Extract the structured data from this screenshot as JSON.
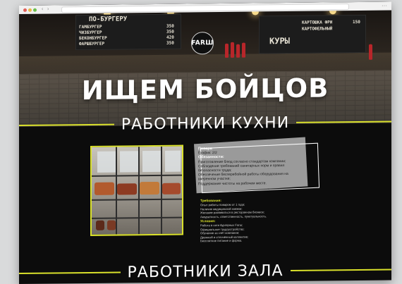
{
  "hero": {
    "logo": "FARШ",
    "title": "ИЩЕМ БОЙЦОВ",
    "board_left": {
      "heading": "ПО-БУРГЕРУ",
      "rows": [
        {
          "name": "ГАМБУРГЕР",
          "price": "350"
        },
        {
          "name": "ЧИЗБУРГЕР",
          "price": "350"
        },
        {
          "name": "БЕКОНБУРГЕР",
          "price": "420"
        },
        {
          "name": "ФАРШБУРГЕР",
          "price": "350"
        }
      ]
    },
    "board_right": {
      "rows": [
        {
          "name": "КАРТОШКА ФРИ",
          "price": "150"
        },
        {
          "name": "КАРТОФЕЛЬНЫЙ",
          "price": ""
        },
        {
          "name": "КУРЫ",
          "price": ""
        }
      ]
    }
  },
  "sections": {
    "kitchen": "РАБОТНИКИ КУХНИ",
    "hall": "РАБОТНИКИ ЗАЛА"
  },
  "vacancy": {
    "title": "Повара",
    "schedule": "График: 2/2",
    "duties_heading": "Обязанности:",
    "duties": [
      "Приготовление блюд согласно стандартам компании;",
      "Соблюдение требований санитарных норм и правил безопасности труда;",
      "Обеспечение бесперебойной работы оборудования на вверенном участке;",
      "Поддержание чистоты на рабочем месте."
    ],
    "requirements_heading": "Требования:",
    "requirements": [
      "Опыт работы поваром от 1 года;",
      "Наличие медицинской книжки;",
      "Желание развиваться в ресторанном бизнесе;",
      "Аккуратность, ответственность, пунктуальность."
    ],
    "conditions_heading": "Условия:",
    "conditions": [
      "Работа в сети бургерных Farш;",
      "Официальное трудоустройство;",
      "Обучение за счёт компании;",
      "Дружный и сплочённый коллектив;",
      "Бесплатное питание и форма."
    ]
  }
}
